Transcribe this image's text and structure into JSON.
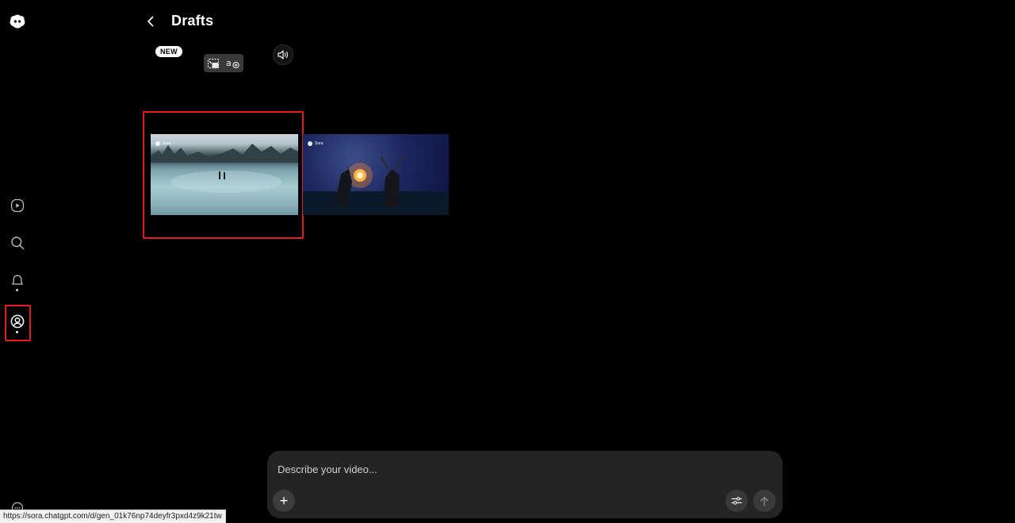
{
  "header": {
    "title": "Drafts"
  },
  "toolbar": {
    "new_badge": "NEW",
    "icons": [
      "crop-icon",
      "translate-icon",
      "sound-icon"
    ]
  },
  "sidebar": {
    "logo": "sora-logo",
    "items": [
      {
        "name": "video-feed",
        "icon": "play-circle-icon"
      },
      {
        "name": "search",
        "icon": "search-icon"
      },
      {
        "name": "notifications",
        "icon": "bell-icon"
      },
      {
        "name": "profile",
        "icon": "profile-icon",
        "active": true
      }
    ]
  },
  "drafts": [
    {
      "watermark": "Sora",
      "scene": "frozen-lake-forest",
      "selected": true
    },
    {
      "watermark": "Sora",
      "scene": "night-warriors-fire"
    }
  ],
  "composer": {
    "placeholder": "Describe your video...",
    "add_label": "+"
  },
  "status_bar": {
    "url": "https://sora.chatgpt.com/d/gen_01k76np74deyfr3pxd4z9k21tw"
  },
  "colors": {
    "background": "#000000",
    "highlight": "#e11d1d",
    "composer_bg": "#242424"
  }
}
